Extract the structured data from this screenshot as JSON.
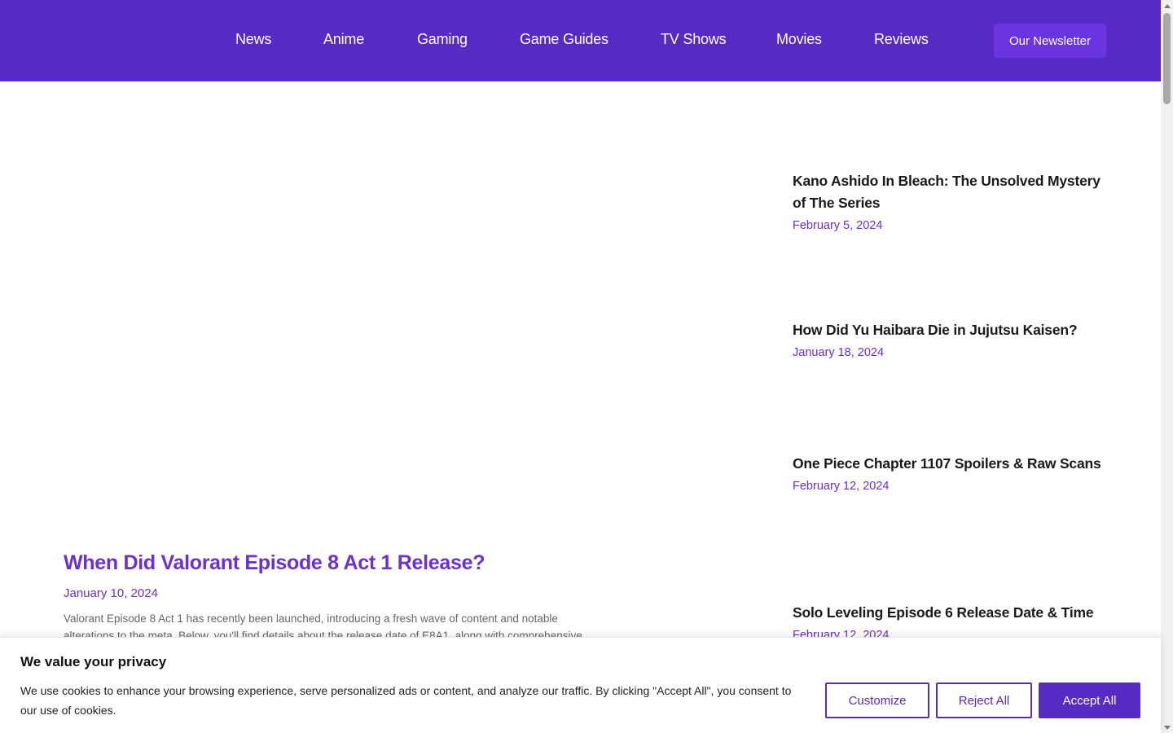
{
  "colors": {
    "brand": "#582ac4",
    "accent_text": "#6b2fd6"
  },
  "nav": {
    "items": [
      {
        "label": "News"
      },
      {
        "label": "Anime"
      },
      {
        "label": "Gaming"
      },
      {
        "label": "Game Guides"
      },
      {
        "label": "TV Shows"
      },
      {
        "label": "Movies"
      },
      {
        "label": "Reviews"
      }
    ],
    "newsletter_label": "Our Newsletter"
  },
  "main_article": {
    "title": "When Did Valorant Episode 8 Act 1 Release?",
    "date": "January 10, 2024",
    "excerpt": "Valorant Episode 8 Act 1 has recently been launched, introducing a fresh wave of content and notable alterations to the meta. Below, you'll find details about the release date of E8A1, along with comprehensive"
  },
  "sidebar": {
    "items": [
      {
        "title": "Kano Ashido In Bleach: The Unsolved Mystery of The Series",
        "date": "February 5, 2024"
      },
      {
        "title": "How Did Yu Haibara Die in Jujutsu Kaisen?",
        "date": "January 18, 2024"
      },
      {
        "title": "One Piece Chapter 1107 Spoilers & Raw Scans",
        "date": "February 12, 2024"
      },
      {
        "title": "Solo Leveling Episode 6 Release Date & Time",
        "date": "February 12, 2024"
      }
    ]
  },
  "cookie": {
    "title": "We value your privacy",
    "text": "We use cookies to enhance your browsing experience, serve personalized ads or content, and analyze our traffic. By clicking \"Accept All\", you consent to our use of cookies.",
    "customize_label": "Customize",
    "reject_label": "Reject All",
    "accept_label": "Accept All"
  }
}
